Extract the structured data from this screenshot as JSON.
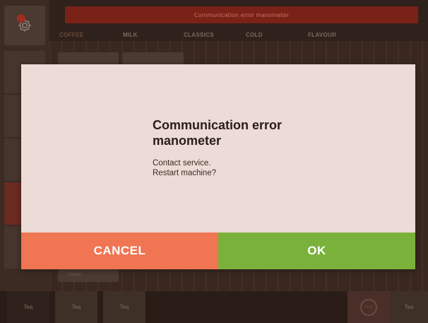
{
  "app": {
    "error_banner": "Communication error manometer",
    "tabs": [
      {
        "label": "COFFEE",
        "active": true
      },
      {
        "label": "MILK",
        "active": false
      },
      {
        "label": "CLASSICS",
        "active": false
      },
      {
        "label": "COLD",
        "active": false
      },
      {
        "label": "FLAVOUR",
        "active": false
      }
    ],
    "partial_tile_label": "Steppe",
    "bottom_tiles": [
      {
        "label": "Tea"
      },
      {
        "label": "Tea"
      },
      {
        "label": "Tea"
      },
      {
        "label": "Tea"
      }
    ],
    "circle_button_label": "Stop"
  },
  "dialog": {
    "title": "Communication error manometer",
    "message_lines": [
      "Contact service.",
      "Restart machine?"
    ],
    "cancel_label": "CANCEL",
    "ok_label": "OK"
  },
  "colors": {
    "dialog_bg": "#ecdbd6",
    "cancel_bg": "#f07552",
    "ok_bg": "#7ab13b",
    "banner_bg": "#7a2218"
  },
  "icons": {
    "settings": "gear-icon",
    "alert": "alert-dot-icon",
    "stop": "stop-circle-icon"
  }
}
